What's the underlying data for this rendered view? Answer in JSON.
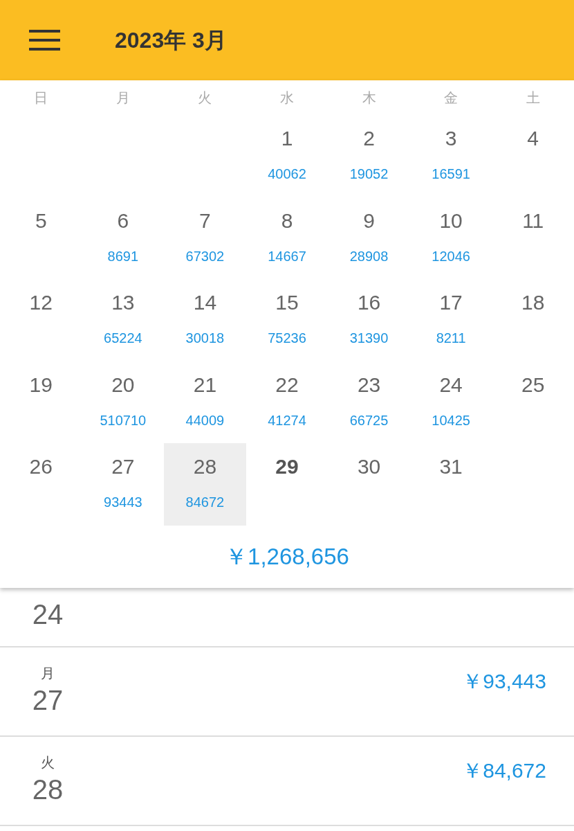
{
  "app_bar": {
    "title": "2023年 3月"
  },
  "weekdays": [
    "日",
    "月",
    "火",
    "水",
    "木",
    "金",
    "土"
  ],
  "weeks": [
    [
      {
        "kind": "blank"
      },
      {
        "kind": "blank"
      },
      {
        "kind": "blank"
      },
      {
        "kind": "day",
        "day": "1",
        "amount": "40062",
        "selected": false,
        "today": false
      },
      {
        "kind": "day",
        "day": "2",
        "amount": "19052",
        "selected": false,
        "today": false
      },
      {
        "kind": "day",
        "day": "3",
        "amount": "16591",
        "selected": false,
        "today": false
      },
      {
        "kind": "day",
        "day": "4",
        "selected": false,
        "today": false
      }
    ],
    [
      {
        "kind": "day",
        "day": "5",
        "selected": false,
        "today": false
      },
      {
        "kind": "day",
        "day": "6",
        "amount": "8691",
        "selected": false,
        "today": false
      },
      {
        "kind": "day",
        "day": "7",
        "amount": "67302",
        "selected": false,
        "today": false
      },
      {
        "kind": "day",
        "day": "8",
        "amount": "14667",
        "selected": false,
        "today": false
      },
      {
        "kind": "day",
        "day": "9",
        "amount": "28908",
        "selected": false,
        "today": false
      },
      {
        "kind": "day",
        "day": "10",
        "amount": "12046",
        "selected": false,
        "today": false
      },
      {
        "kind": "day",
        "day": "11",
        "selected": false,
        "today": false
      }
    ],
    [
      {
        "kind": "day",
        "day": "12",
        "selected": false,
        "today": false
      },
      {
        "kind": "day",
        "day": "13",
        "amount": "65224",
        "selected": false,
        "today": false
      },
      {
        "kind": "day",
        "day": "14",
        "amount": "30018",
        "selected": false,
        "today": false
      },
      {
        "kind": "day",
        "day": "15",
        "amount": "75236",
        "selected": false,
        "today": false
      },
      {
        "kind": "day",
        "day": "16",
        "amount": "31390",
        "selected": false,
        "today": false
      },
      {
        "kind": "day",
        "day": "17",
        "amount": "8211",
        "selected": false,
        "today": false
      },
      {
        "kind": "day",
        "day": "18",
        "selected": false,
        "today": false
      }
    ],
    [
      {
        "kind": "day",
        "day": "19",
        "selected": false,
        "today": false
      },
      {
        "kind": "day",
        "day": "20",
        "amount": "510710",
        "selected": false,
        "today": false
      },
      {
        "kind": "day",
        "day": "21",
        "amount": "44009",
        "selected": false,
        "today": false
      },
      {
        "kind": "day",
        "day": "22",
        "amount": "41274",
        "selected": false,
        "today": false
      },
      {
        "kind": "day",
        "day": "23",
        "amount": "66725",
        "selected": false,
        "today": false
      },
      {
        "kind": "day",
        "day": "24",
        "amount": "10425",
        "selected": false,
        "today": false
      },
      {
        "kind": "day",
        "day": "25",
        "selected": false,
        "today": false
      }
    ],
    [
      {
        "kind": "day",
        "day": "26",
        "selected": false,
        "today": false
      },
      {
        "kind": "day",
        "day": "27",
        "amount": "93443",
        "selected": false,
        "today": false
      },
      {
        "kind": "day",
        "day": "28",
        "amount": "84672",
        "selected": true,
        "today": false
      },
      {
        "kind": "day",
        "day": "29",
        "selected": false,
        "today": true
      },
      {
        "kind": "day",
        "day": "30",
        "selected": false,
        "today": false
      },
      {
        "kind": "day",
        "day": "31",
        "selected": false,
        "today": false
      },
      {
        "kind": "blank"
      }
    ]
  ],
  "month_total": "￥1,268,656",
  "entries": [
    {
      "day": "24"
    },
    {
      "weekday": "月",
      "day": "27",
      "amount": "￥93,443"
    },
    {
      "weekday": "火",
      "day": "28",
      "amount": "￥84,672"
    }
  ]
}
